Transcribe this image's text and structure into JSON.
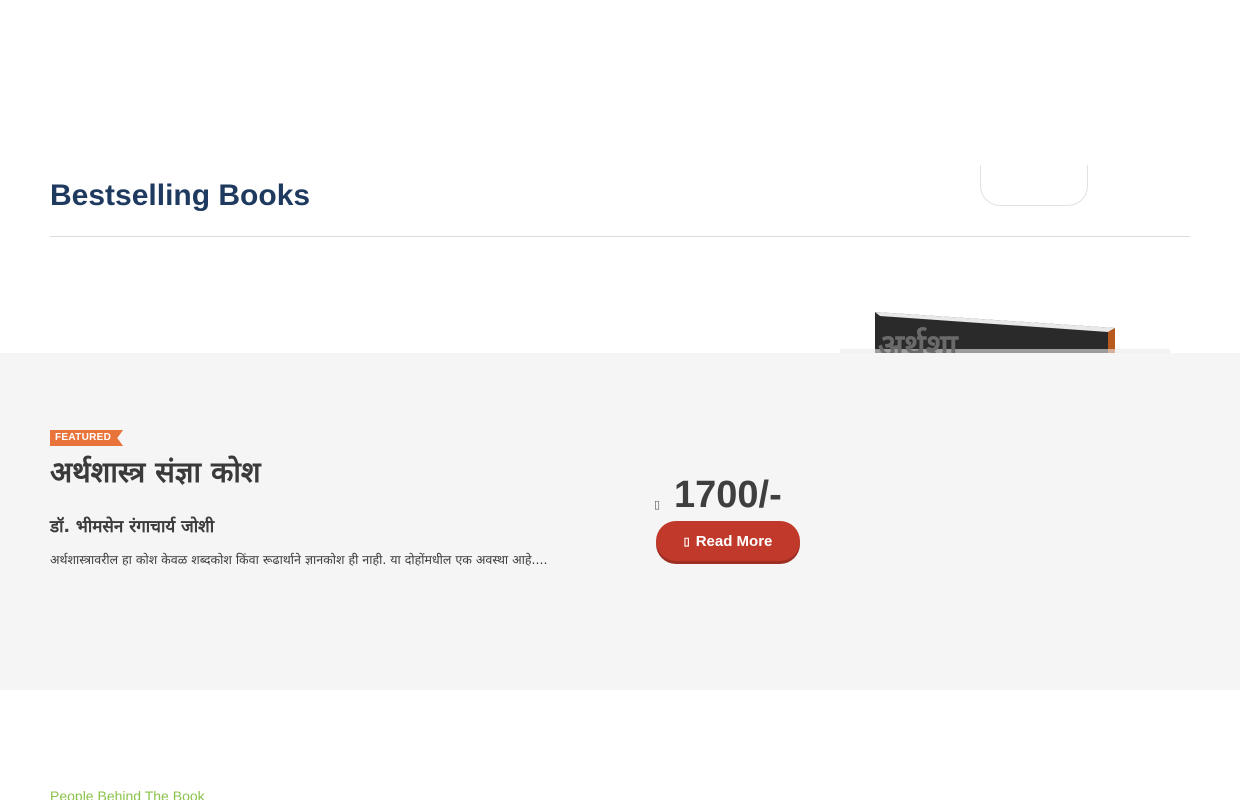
{
  "section": {
    "title": "Bestselling Books",
    "view_all_label": ""
  },
  "featured": {
    "badge": "FEATURED",
    "title": "अर्थशास्त्र संज्ञा कोश",
    "author": "डॉ. भीमसेन रंगाचार्य जोशी",
    "description": "अर्थशास्त्रावरील हा कोश केवळ शब्दकोश किंवा रूढार्थाने ज्ञानकोश ही नाही. या दोहोंमधील एक अवस्था आहे....",
    "price": "1700/-",
    "price_icon": "rupee-icon",
    "read_more_label": "Read More",
    "read_more_icon": "book-icon",
    "cover_text": "अर्थशा"
  },
  "footer_section": {
    "people_link": "People Behind The Book"
  },
  "colors": {
    "title": "#1f3a5f",
    "badge": "#e8743b",
    "button": "#c0392b",
    "link": "#8bc34a",
    "band": "#f5f5f5"
  }
}
